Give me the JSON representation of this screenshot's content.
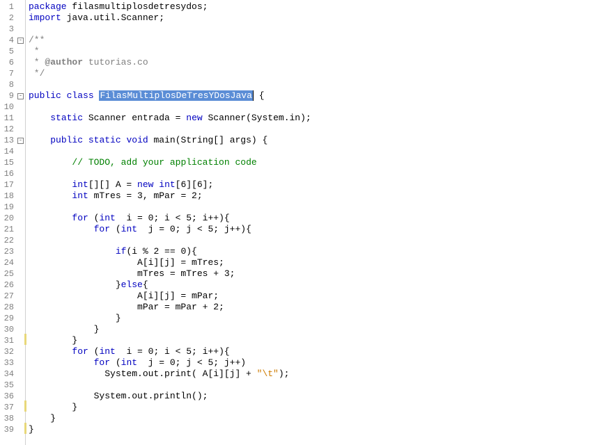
{
  "lines": [
    {
      "n": 1,
      "segs": [
        {
          "t": "kw",
          "v": "package"
        },
        {
          "t": "",
          "v": " filasmultiplosdetresydos;"
        }
      ]
    },
    {
      "n": 2,
      "segs": [
        {
          "t": "kw",
          "v": "import"
        },
        {
          "t": "",
          "v": " java.util.Scanner;"
        }
      ]
    },
    {
      "n": 3,
      "segs": []
    },
    {
      "n": 4,
      "fold": "-",
      "segs": [
        {
          "t": "doc",
          "v": "/**"
        }
      ]
    },
    {
      "n": 5,
      "segs": [
        {
          "t": "doc",
          "v": " *"
        }
      ]
    },
    {
      "n": 6,
      "segs": [
        {
          "t": "doc",
          "v": " * "
        },
        {
          "t": "doctag",
          "v": "@author"
        },
        {
          "t": "doc",
          "v": " tutorias.co"
        }
      ]
    },
    {
      "n": 7,
      "segs": [
        {
          "t": "doc",
          "v": " */"
        }
      ]
    },
    {
      "n": 8,
      "segs": []
    },
    {
      "n": 9,
      "fold": "-",
      "segs": [
        {
          "t": "kw",
          "v": "public"
        },
        {
          "t": "",
          "v": " "
        },
        {
          "t": "kw",
          "v": "class"
        },
        {
          "t": "",
          "v": " "
        },
        {
          "t": "hl",
          "v": "FilasMultiplosDeTresYDosJava"
        },
        {
          "t": "cursor",
          "v": ""
        },
        {
          "t": "",
          "v": " {"
        }
      ]
    },
    {
      "n": 10,
      "segs": []
    },
    {
      "n": 11,
      "segs": [
        {
          "t": "",
          "v": "    "
        },
        {
          "t": "kw",
          "v": "static"
        },
        {
          "t": "",
          "v": " Scanner entrada = "
        },
        {
          "t": "kw",
          "v": "new"
        },
        {
          "t": "",
          "v": " Scanner(System.in);"
        }
      ]
    },
    {
      "n": 12,
      "segs": []
    },
    {
      "n": 13,
      "fold": "-",
      "segs": [
        {
          "t": "",
          "v": "    "
        },
        {
          "t": "kw",
          "v": "public"
        },
        {
          "t": "",
          "v": " "
        },
        {
          "t": "kw",
          "v": "static"
        },
        {
          "t": "",
          "v": " "
        },
        {
          "t": "kw",
          "v": "void"
        },
        {
          "t": "",
          "v": " main(String[] args) {"
        }
      ]
    },
    {
      "n": 14,
      "segs": []
    },
    {
      "n": 15,
      "segs": [
        {
          "t": "",
          "v": "        "
        },
        {
          "t": "todo",
          "v": "// TODO, add your application code"
        }
      ]
    },
    {
      "n": 16,
      "segs": []
    },
    {
      "n": 17,
      "segs": [
        {
          "t": "",
          "v": "        "
        },
        {
          "t": "kw",
          "v": "int"
        },
        {
          "t": "",
          "v": "[][] A = "
        },
        {
          "t": "kw",
          "v": "new"
        },
        {
          "t": "",
          "v": " "
        },
        {
          "t": "kw",
          "v": "int"
        },
        {
          "t": "",
          "v": "[6][6];"
        }
      ]
    },
    {
      "n": 18,
      "segs": [
        {
          "t": "",
          "v": "        "
        },
        {
          "t": "kw",
          "v": "int"
        },
        {
          "t": "",
          "v": " mTres = 3, mPar = 2;"
        }
      ]
    },
    {
      "n": 19,
      "segs": []
    },
    {
      "n": 20,
      "segs": [
        {
          "t": "",
          "v": "        "
        },
        {
          "t": "kw",
          "v": "for"
        },
        {
          "t": "",
          "v": " ("
        },
        {
          "t": "kw",
          "v": "int"
        },
        {
          "t": "",
          "v": "  i = 0; i < 5; i++){"
        }
      ]
    },
    {
      "n": 21,
      "segs": [
        {
          "t": "",
          "v": "            "
        },
        {
          "t": "kw",
          "v": "for"
        },
        {
          "t": "",
          "v": " ("
        },
        {
          "t": "kw",
          "v": "int"
        },
        {
          "t": "",
          "v": "  j = 0; j < 5; j++){"
        }
      ]
    },
    {
      "n": 22,
      "segs": []
    },
    {
      "n": 23,
      "segs": [
        {
          "t": "",
          "v": "                "
        },
        {
          "t": "kw",
          "v": "if"
        },
        {
          "t": "",
          "v": "(i % 2 == 0){"
        }
      ]
    },
    {
      "n": 24,
      "segs": [
        {
          "t": "",
          "v": "                    A[i][j] = mTres;"
        }
      ]
    },
    {
      "n": 25,
      "segs": [
        {
          "t": "",
          "v": "                    mTres = mTres + 3;"
        }
      ]
    },
    {
      "n": 26,
      "segs": [
        {
          "t": "",
          "v": "                }"
        },
        {
          "t": "kw",
          "v": "else"
        },
        {
          "t": "",
          "v": "{"
        }
      ]
    },
    {
      "n": 27,
      "segs": [
        {
          "t": "",
          "v": "                    A[i][j] = mPar;"
        }
      ]
    },
    {
      "n": 28,
      "segs": [
        {
          "t": "",
          "v": "                    mPar = mPar + 2;"
        }
      ]
    },
    {
      "n": 29,
      "segs": [
        {
          "t": "",
          "v": "                }"
        }
      ]
    },
    {
      "n": 30,
      "segs": [
        {
          "t": "",
          "v": "            }"
        }
      ]
    },
    {
      "n": 31,
      "mark": true,
      "segs": [
        {
          "t": "",
          "v": "        }"
        }
      ]
    },
    {
      "n": 32,
      "segs": [
        {
          "t": "",
          "v": "        "
        },
        {
          "t": "kw",
          "v": "for"
        },
        {
          "t": "",
          "v": " ("
        },
        {
          "t": "kw",
          "v": "int"
        },
        {
          "t": "",
          "v": "  i = 0; i < 5; i++){"
        }
      ]
    },
    {
      "n": 33,
      "segs": [
        {
          "t": "",
          "v": "            "
        },
        {
          "t": "kw",
          "v": "for"
        },
        {
          "t": "",
          "v": " ("
        },
        {
          "t": "kw",
          "v": "int"
        },
        {
          "t": "",
          "v": "  j = 0; j < 5; j++)"
        }
      ]
    },
    {
      "n": 34,
      "segs": [
        {
          "t": "",
          "v": "              System.out.print( A[i][j] + "
        },
        {
          "t": "str",
          "v": "\"\\t\""
        },
        {
          "t": "",
          "v": ");"
        }
      ]
    },
    {
      "n": 35,
      "segs": []
    },
    {
      "n": 36,
      "segs": [
        {
          "t": "",
          "v": "            System.out.println();"
        }
      ]
    },
    {
      "n": 37,
      "mark": true,
      "segs": [
        {
          "t": "",
          "v": "        }"
        }
      ]
    },
    {
      "n": 38,
      "segs": [
        {
          "t": "",
          "v": "    }"
        }
      ]
    },
    {
      "n": 39,
      "mark": true,
      "segs": [
        {
          "t": "",
          "v": "}"
        }
      ]
    }
  ]
}
